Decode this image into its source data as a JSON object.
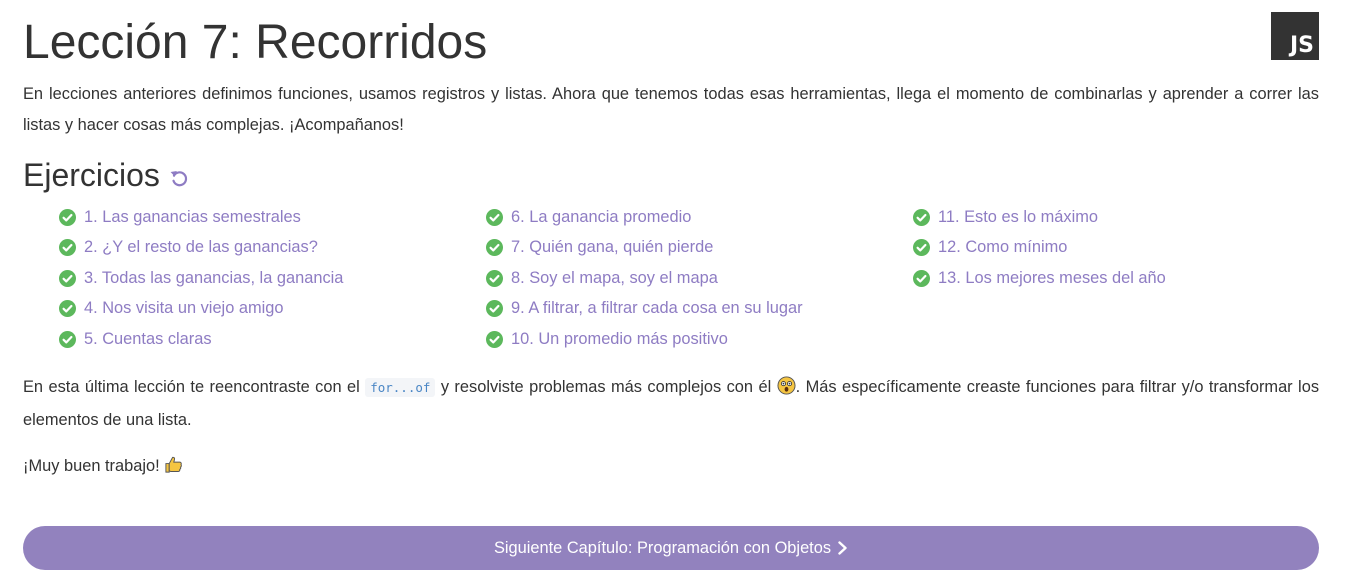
{
  "lesson": {
    "title": "Lección 7: Recorridos",
    "logo_text": "JS",
    "intro": "En lecciones anteriores definimos funciones, usamos registros y listas. Ahora que tenemos todas esas herramientas, llega el momento de combinarlas y aprender a correr las listas y hacer cosas más complejas. ¡Acompañanos!"
  },
  "exercises": {
    "heading": "Ejercicios",
    "reset_icon": "undo-icon",
    "status_icon": "check-circle-icon",
    "status_color": "#5cb85c",
    "link_color": "#8e7cc3",
    "columns": [
      [
        "1. Las ganancias semestrales",
        "2. ¿Y el resto de las ganancias?",
        "3. Todas las ganancias, la ganancia",
        "4. Nos visita un viejo amigo",
        "5. Cuentas claras"
      ],
      [
        "6. La ganancia promedio",
        "7. Quién gana, quién pierde",
        "8. Soy el mapa, soy el mapa",
        "9. A filtrar, a filtrar cada cosa en su lugar",
        "10. Un promedio más positivo"
      ],
      [
        "11. Esto es lo máximo",
        "12. Como mínimo",
        "13. Los mejores meses del año"
      ]
    ]
  },
  "summary": {
    "before_code": "En esta última lección te reencontraste con el ",
    "code": "for...of",
    "after_code": " y resolviste problemas más complejos con él ",
    "emoji": "astonished-face-icon",
    "after_emoji": ". Más específicamente creaste funciones para filtrar y/o transformar los elementos de una lista."
  },
  "praise": {
    "text": "¡Muy buen trabajo! ",
    "emoji": "thumbs-up-icon"
  },
  "next_button": {
    "label": "Siguiente Capítulo: Programación con Objetos",
    "icon": "chevron-right-icon",
    "color": "#9282be"
  }
}
